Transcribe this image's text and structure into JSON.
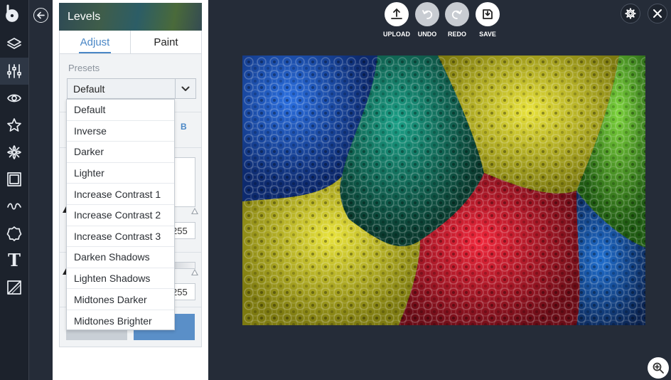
{
  "panel": {
    "title": "Levels",
    "tabs": [
      {
        "label": "Adjust"
      },
      {
        "label": "Paint"
      }
    ],
    "presets_label": "Presets",
    "selected_preset": "Default",
    "channel_b": "B",
    "max_value_1": "255",
    "max_value_2": "255"
  },
  "dropdown": {
    "options": [
      "Default",
      "Inverse",
      "Darker",
      "Lighter",
      "Increase Contrast 1",
      "Increase Contrast 2",
      "Increase Contrast 3",
      "Darken Shadows",
      "Lighten Shadows",
      "Midtones Darker",
      "Midtones Brighter"
    ]
  },
  "toolbar": {
    "upload_label": "UPLOAD",
    "undo_label": "UNDO",
    "redo_label": "REDO",
    "save_label": "SAVE"
  },
  "icons": {
    "rail": [
      "logo-icon",
      "layers-icon",
      "sliders-icon",
      "eye-icon",
      "star-icon",
      "flower-icon",
      "frame-icon",
      "squiggle-icon",
      "badge-icon",
      "text-icon",
      "texture-icon"
    ],
    "back": "back-arrow-icon",
    "settings": "gear-icon",
    "close": "close-icon",
    "zoom": "zoom-in-icon"
  },
  "colors": {
    "accent": "#4a87c6",
    "background": "#252c38",
    "rail": "#1c222c"
  }
}
